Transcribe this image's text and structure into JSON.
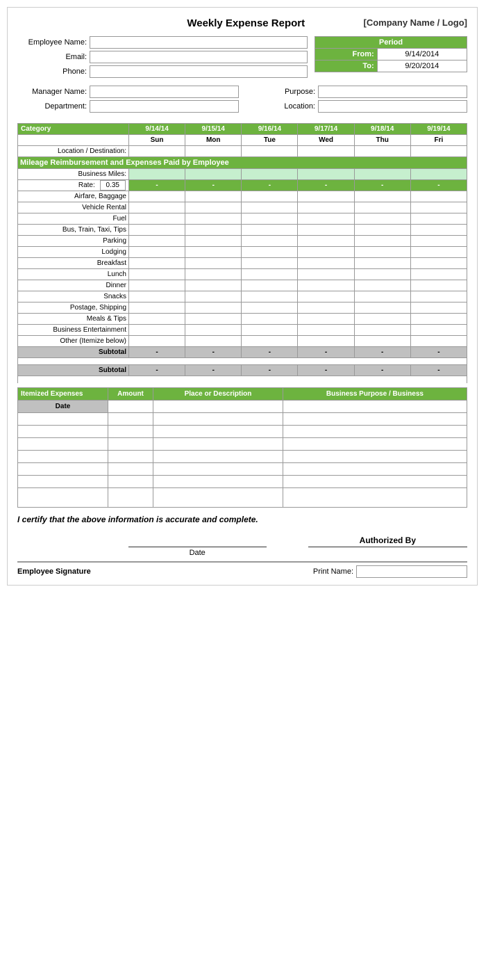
{
  "page": {
    "title": "Weekly Expense Report",
    "company": "[Company Name / Logo]",
    "employee_label": "Employee Name:",
    "email_label": "Email:",
    "phone_label": "Phone:",
    "period_label": "Period",
    "from_label": "From:",
    "to_label": "To:",
    "from_date": "9/14/2014",
    "to_date": "9/20/2014",
    "manager_label": "Manager Name:",
    "purpose_label": "Purpose:",
    "department_label": "Department:",
    "location_label": "Location:",
    "category_label": "Category",
    "dates": [
      "9/14/14",
      "9/15/14",
      "9/16/14",
      "9/17/14",
      "9/18/14",
      "9/19/14"
    ],
    "days": [
      "Sun",
      "Mon",
      "Tue",
      "Wed",
      "Thu",
      "Fri"
    ],
    "location_dest_label": "Location / Destination:",
    "mileage_section_label": "Mileage Reimbursement and Expenses Paid by Employee",
    "business_miles_label": "Business Miles:",
    "rate_label": "Rate:",
    "rate_value": "0.35",
    "dash": "-",
    "categories": [
      "Airfare, Baggage",
      "Vehicle Rental",
      "Fuel",
      "Bus, Train, Taxi, Tips",
      "Parking",
      "Lodging",
      "Breakfast",
      "Lunch",
      "Dinner",
      "Snacks",
      "Postage, Shipping",
      "Meals & Tips",
      "Business Entertainment",
      "Other (Itemize below)"
    ],
    "subtotal_label": "Subtotal",
    "itemized_label": "Itemized Expenses",
    "amount_label": "Amount",
    "place_label": "Place or Description",
    "business_purpose_label": "Business Purpose / Business",
    "date_col_label": "Date",
    "certify_text": "I certify that the above information is accurate and complete.",
    "date_line_label": "Date",
    "authorized_by_label": "Authorized By",
    "employee_signature_label": "Employee Signature",
    "print_name_label": "Print Name:"
  }
}
